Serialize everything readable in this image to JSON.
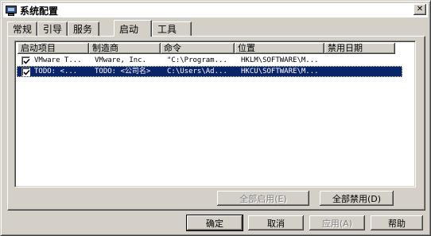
{
  "window": {
    "title": "系统配置",
    "close_label": "✕"
  },
  "tabs": [
    {
      "label": "常规"
    },
    {
      "label": "引导"
    },
    {
      "label": "服务"
    },
    {
      "label": "启动"
    },
    {
      "label": "工具"
    }
  ],
  "active_tab": "启动",
  "table": {
    "columns": [
      "启动项目",
      "制造商",
      "命令",
      "位置",
      "禁用日期"
    ],
    "rows": [
      {
        "item": "VMware T...",
        "maker": "VMware, Inc.",
        "command": "\"C:\\Program...",
        "location": "HKLM\\SOFTWARE\\M...",
        "date": "",
        "checked": true,
        "selected": false
      },
      {
        "item": "TODO: <...",
        "maker": "TODO: <公司名>",
        "command": "C:\\Users\\Ad...",
        "location": "HKCU\\SOFTWARE\\M...",
        "date": "",
        "checked": true,
        "selected": true
      }
    ]
  },
  "buttons": {
    "enable_all": "全部启用(E)",
    "disable_all": "全部禁用(D)",
    "ok": "确定",
    "cancel": "取消",
    "apply": "应用(A)",
    "help": "帮助"
  }
}
